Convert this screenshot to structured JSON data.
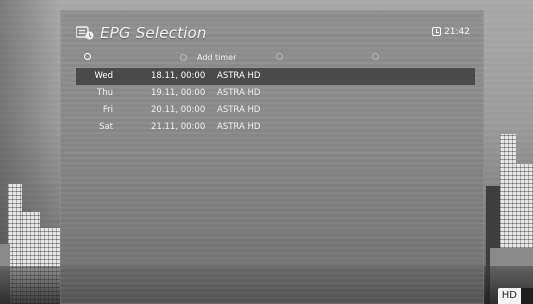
{
  "header": {
    "title": "EPG Selection",
    "clock": "21:42",
    "icon": "epg-list-icon"
  },
  "buttons": [
    {
      "color": "red",
      "label": ""
    },
    {
      "color": "green",
      "label": "Add timer"
    },
    {
      "color": "yellow",
      "label": ""
    },
    {
      "color": "blue",
      "label": ""
    }
  ],
  "schedule": [
    {
      "day": "Wed",
      "datetime": "18.11, 00:00",
      "channel": "ASTRA HD",
      "selected": true
    },
    {
      "day": "Thu",
      "datetime": "19.11, 00:00",
      "channel": "ASTRA HD",
      "selected": false
    },
    {
      "day": "Fri",
      "datetime": "20.11, 00:00",
      "channel": "ASTRA HD",
      "selected": false
    },
    {
      "day": "Sat",
      "datetime": "21.11, 00:00",
      "channel": "ASTRA HD",
      "selected": false
    }
  ],
  "badge": {
    "hd": "HD"
  },
  "colors": {
    "selected_row": "#4a4a4a",
    "text": "#efefef",
    "panel": "#787878"
  }
}
